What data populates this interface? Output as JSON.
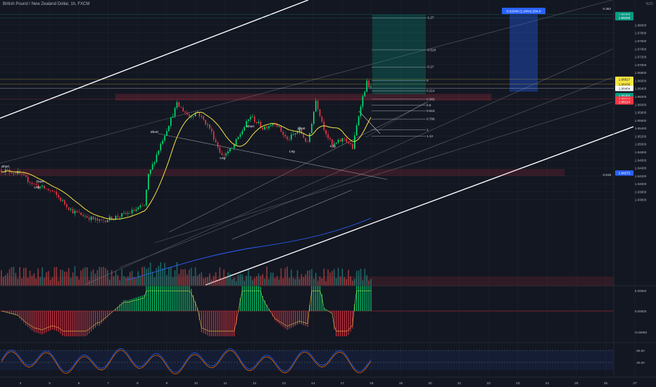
{
  "header": {
    "title": "British Pound / New Zealand Dollar, 1h, FXCM",
    "currency": "NZD"
  },
  "chart_data": {
    "type": "candlestick",
    "y_axis": {
      "range": [
        1.9145,
        1.9845
      ],
      "ticks": [
        "1.98000",
        "1.97800",
        "1.97600",
        "1.97400",
        "1.97200",
        "1.97000",
        "1.96800",
        "1.96600",
        "1.96400",
        "1.96200",
        "1.96000",
        "1.95800",
        "1.95600",
        "1.95400",
        "1.95200",
        "1.95000",
        "1.94800",
        "1.94600",
        "1.94400",
        "1.94200",
        "1.94000",
        "1.93800",
        "1.93600"
      ]
    },
    "price_labels": [
      {
        "text": "1.98268",
        "value": 1.9826,
        "color": "#089981",
        "kind": "tp"
      },
      {
        "text": "1.98268",
        "value": 1.9818,
        "color": "#089981",
        "kind": "tp2"
      },
      {
        "text": "1.96627",
        "value": 1.9663,
        "color": "#f5e642",
        "kind": "fib"
      },
      {
        "text": "1.96430",
        "value": 1.9651,
        "color": "#f5e642",
        "kind": "fib2"
      },
      {
        "text": "1.96404",
        "value": 1.964,
        "color": "#ffffff",
        "kind": "last"
      },
      {
        "text": "1.96260",
        "value": 1.9622,
        "color": "#089981",
        "kind": "entry"
      },
      {
        "text": "1.96114",
        "value": 1.9613,
        "color": "#f23645",
        "kind": "sl"
      },
      {
        "text": "1.96114",
        "value": 1.9606,
        "color": "#f23645",
        "kind": "sl2"
      },
      {
        "text": "1.94272",
        "value": 1.9427,
        "color": "#2962ff",
        "kind": "ma"
      }
    ],
    "position_box_label": "0.02040 (1.04%) 204.0",
    "fib_levels": [
      {
        "label": "-1.27",
        "value": 1.9818
      },
      {
        "label": "-0.618",
        "value": 1.9737
      },
      {
        "label": "-0.27",
        "value": 1.9694
      },
      {
        "label": "0",
        "value": 1.966
      },
      {
        "label": "0.214",
        "value": 1.9634
      },
      {
        "label": "0.382",
        "value": 1.9613
      },
      {
        "label": "0.5",
        "value": 1.9598
      },
      {
        "label": "0.618",
        "value": 1.9584
      },
      {
        "label": "0.786",
        "value": 1.9563
      },
      {
        "label": "1",
        "value": 1.9536
      },
      {
        "label": "1.13",
        "value": 1.952
      }
    ],
    "other_fib_labels": [
      {
        "label": "0.382",
        "value": 1.9836
      },
      {
        "label": "0.618",
        "value": 1.9418
      }
    ],
    "signals": [
      {
        "label": "Short",
        "x_index": 0,
        "value": 1.9441
      },
      {
        "label": "Short",
        "x_index": 17,
        "value": 1.9403
      },
      {
        "label": "Lng",
        "x_index": 16,
        "value": 1.9389
      },
      {
        "label": "Short",
        "x_index": 73,
        "value": 1.9528
      },
      {
        "label": "Lng",
        "x_index": 107,
        "value": 1.9462
      },
      {
        "label": "Short",
        "x_index": 120,
        "value": 1.9542
      },
      {
        "label": "Short",
        "x_index": 145,
        "value": 1.9537
      },
      {
        "label": "Lng",
        "x_index": 141,
        "value": 1.9479
      },
      {
        "label": "Lng",
        "x_index": 161,
        "value": 1.9492
      }
    ],
    "x_axis": {
      "labels": [
        "4",
        "5",
        "6",
        "7",
        "8",
        "9",
        "10",
        "11",
        "12",
        "13",
        "14",
        "17",
        "18",
        "19",
        "20",
        "21",
        "22",
        "23",
        "24",
        "25",
        "26",
        "27"
      ]
    },
    "macd_axis": {
      "ticks": [
        "0.00050",
        "0.00000",
        "-0.00050"
      ]
    },
    "stoch_axis": {
      "ticks": [
        "80.00",
        "40.00"
      ]
    }
  }
}
